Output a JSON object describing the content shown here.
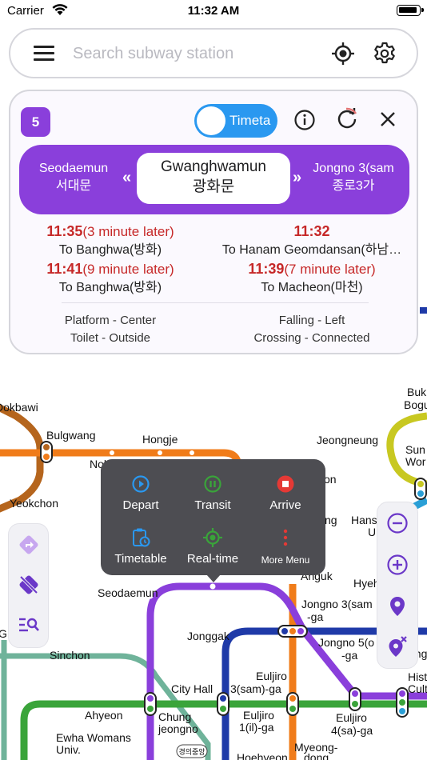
{
  "status_bar": {
    "carrier": "Carrier",
    "time": "11:32 AM"
  },
  "search": {
    "placeholder": "Search subway station"
  },
  "card": {
    "line_number": "5",
    "line_color": "#8a3fdb",
    "toggle_label": "Timeta",
    "toggle_on": true,
    "prev_station": {
      "en": "Seodaemun",
      "ko": "서대문"
    },
    "current_station": {
      "en": "Gwanghwamun",
      "ko": "광화문"
    },
    "next_station": {
      "en": "Jongno 3(sam",
      "ko": "종로3가"
    },
    "chevron_left": "«",
    "chevron_right": "»",
    "arrivals_left": [
      {
        "time": "11:35",
        "later": "(3 minute later)",
        "dest": "To Banghwa(방화)"
      },
      {
        "time": "11:41",
        "later": "(9 minute later)",
        "dest": "To Banghwa(방화)"
      }
    ],
    "arrivals_right": [
      {
        "time": "11:32",
        "later": "",
        "dest": "To Hanam Geomdansan(하남…"
      },
      {
        "time": "11:39",
        "later": "(7 minute later)",
        "dest": "To Macheon(마천)"
      }
    ],
    "info_left": [
      "Platform - Center",
      "Toilet - Outside"
    ],
    "info_right": [
      "Falling - Left",
      "Crossing - Connected"
    ]
  },
  "popup_menu": {
    "items": [
      {
        "label": "Depart",
        "icon": "play-circle-icon"
      },
      {
        "label": "Transit",
        "icon": "pause-circle-icon"
      },
      {
        "label": "Arrive",
        "icon": "stop-square-icon"
      },
      {
        "label": "Timetable",
        "icon": "clipboard-clock-icon"
      },
      {
        "label": "Real-time",
        "icon": "gps-target-icon"
      },
      {
        "label": "More Menu",
        "icon": "vertical-dots-icon"
      }
    ]
  },
  "map": {
    "stations": [
      "Dokbawi",
      "Bulgwang",
      "Hongje",
      "Jeongneung",
      "Buk",
      "Bogu",
      "Sun",
      "Wor",
      "Nok",
      "Yeokchon",
      "Seodaemun",
      "Jonggak",
      "Jongno 3(sam",
      "-ga",
      "Jongno 5(o",
      "-ga",
      "Anguk",
      "Hyeh",
      "ng",
      "Hansu",
      "U",
      "Sinchon",
      "City Hall",
      "Euljiro",
      "3(sam)-ga",
      "Ahyeon",
      "Chung",
      "jeongno",
      "Euljiro",
      "1(il)-ga",
      "Euljiro",
      "4(sa)-ga",
      "Ewha Womans",
      "Univ.",
      "Myeong-",
      "dong",
      "Hoehyeon",
      "Hist",
      "Cult",
      "on",
      "Jong",
      "G",
      "경의중앙",
      "eo"
    ],
    "line_colors": {
      "line1": "#1f3aa8",
      "line2": "#3aa43a",
      "line3": "#f07c1a",
      "line4": "#2a9fd6",
      "line5": "#8a3fdb",
      "line6": "#b5651d",
      "gyeongui": "#6fb39a",
      "ui": "#c8c821"
    }
  }
}
